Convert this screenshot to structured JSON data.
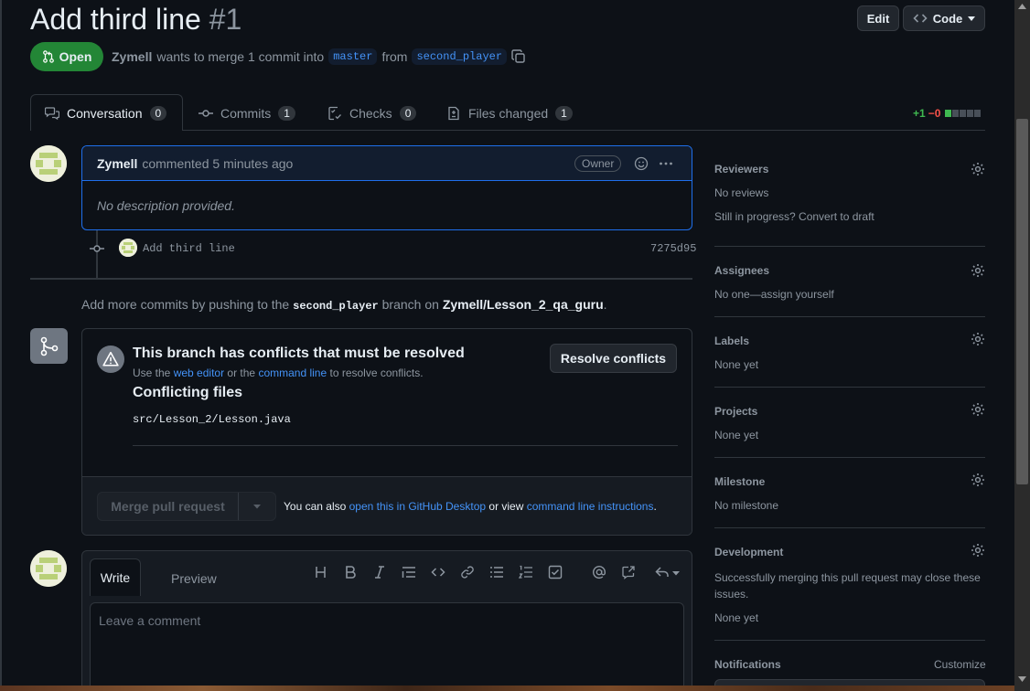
{
  "header": {
    "title": "Add third line",
    "number": "#1",
    "edit_label": "Edit",
    "code_label": "Code",
    "state_label": "Open",
    "author": "Zymell",
    "merge_text": "wants to merge 1 commit into",
    "base_branch": "master",
    "from_text": "from",
    "head_branch": "second_player"
  },
  "tabs": [
    {
      "label": "Conversation",
      "count": "0"
    },
    {
      "label": "Commits",
      "count": "1"
    },
    {
      "label": "Checks",
      "count": "0"
    },
    {
      "label": "Files changed",
      "count": "1"
    }
  ],
  "diffstat": {
    "added": "+1",
    "removed": "−0"
  },
  "comment": {
    "author": "Zymell",
    "action": "commented 5 minutes ago",
    "role": "Owner",
    "body": "No description provided."
  },
  "commit": {
    "message": "Add third line",
    "sha": "7275d95"
  },
  "push_hint": {
    "prefix": "Add more commits by pushing to the",
    "branch": "second_player",
    "middle": "branch on",
    "repo": "Zymell/Lesson_2_qa_guru",
    "suffix": "."
  },
  "conflict": {
    "title": "This branch has conflicts that must be resolved",
    "use_text": "Use the",
    "web_editor": "web editor",
    "or_text": "or the",
    "command_line": "command line",
    "resolve_text": "to resolve conflicts.",
    "resolve_button": "Resolve conflicts",
    "files_heading": "Conflicting files",
    "file": "src/Lesson_2/Lesson.java"
  },
  "merge": {
    "button": "Merge pull request",
    "also_text": "You can also",
    "desktop_link": "open this in GitHub Desktop",
    "or_view": "or view",
    "instructions_link": "command line instructions",
    "end": "."
  },
  "editor": {
    "write_tab": "Write",
    "preview_tab": "Preview",
    "placeholder": "Leave a comment"
  },
  "sidebar": {
    "reviewers": {
      "label": "Reviewers",
      "value": "No reviews",
      "extra": "Still in progress? Convert to draft"
    },
    "assignees": {
      "label": "Assignees",
      "value": "No one—assign yourself"
    },
    "labels": {
      "label": "Labels",
      "value": "None yet"
    },
    "projects": {
      "label": "Projects",
      "value": "None yet"
    },
    "milestone": {
      "label": "Milestone",
      "value": "No milestone"
    },
    "development": {
      "label": "Development",
      "value": "Successfully merging this pull request may close these issues.",
      "extra": "None yet"
    },
    "notifications": {
      "label": "Notifications",
      "action": "Customize"
    }
  },
  "colors": {
    "background": "#0d1117",
    "open_green": "#238636",
    "link_blue": "#4493f8",
    "added_green": "#3fb950",
    "removed_red": "#f85149"
  }
}
